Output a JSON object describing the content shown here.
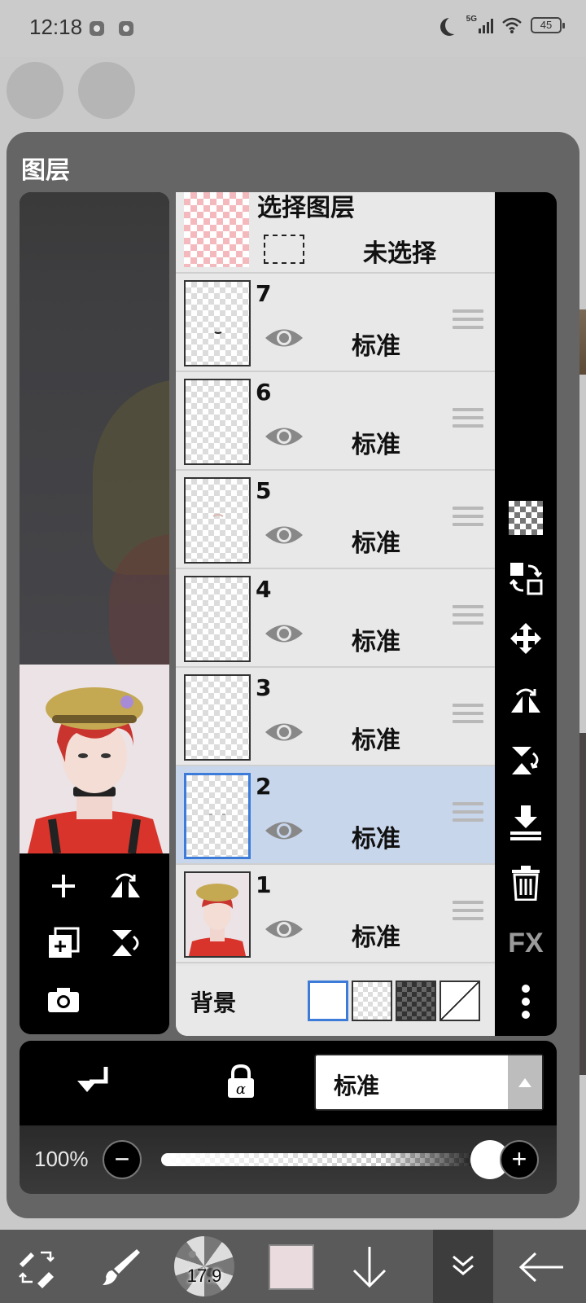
{
  "status_bar": {
    "time": "12:18",
    "network": "5G",
    "battery": "45"
  },
  "layer_panel": {
    "title": "图层",
    "select_layer": {
      "title": "选择图层",
      "value": "未选择"
    },
    "layers": [
      {
        "number": "7",
        "blend": "标准",
        "selected": false
      },
      {
        "number": "6",
        "blend": "标准",
        "selected": false
      },
      {
        "number": "5",
        "blend": "标准",
        "selected": false
      },
      {
        "number": "4",
        "blend": "标准",
        "selected": false
      },
      {
        "number": "3",
        "blend": "标准",
        "selected": false
      },
      {
        "number": "2",
        "blend": "标准",
        "selected": true
      },
      {
        "number": "1",
        "blend": "标准",
        "selected": false
      }
    ],
    "background": {
      "label": "背景"
    },
    "fx_label": "FX",
    "blend_mode": "标准",
    "opacity": "100%"
  },
  "bottom_toolbar": {
    "brush_size": "17.9",
    "current_color": "#e9dbde"
  },
  "colors": {
    "selected_row": "#c8d6ec",
    "selection_border": "#3c7bd8",
    "panel_bg": "#656565"
  }
}
